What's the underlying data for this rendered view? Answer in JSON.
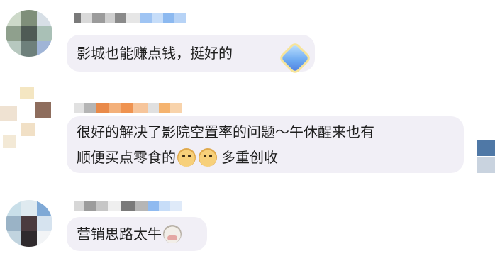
{
  "comments": [
    {
      "text_lines": [
        "影城也能赚点钱，挺好的"
      ],
      "emojis": [
        "diamond-sticker"
      ]
    },
    {
      "text_lines": [
        "很好的解决了影院空置率的问题～午休醒来也有",
        "顺便买点零食的"
      ],
      "trailing_text": "多重创收",
      "emojis": [
        "doge-emoji",
        "doge-emoji"
      ]
    },
    {
      "text_lines": [
        "营销思路太牛"
      ],
      "emojis": [
        "cow-emoji"
      ]
    }
  ],
  "colors": {
    "bubble": "#f1eff6",
    "text": "#1f1f1f",
    "username_blur_blue": "#7fb6f0",
    "username_blur_orange": "#f3a05a"
  }
}
